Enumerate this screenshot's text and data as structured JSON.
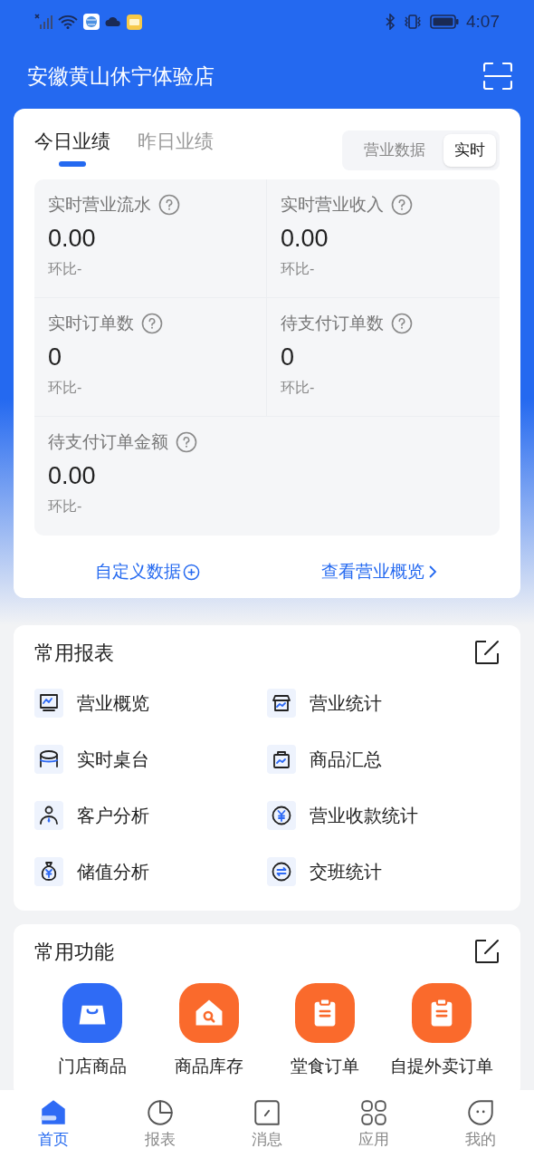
{
  "status_bar": {
    "time": "4:07"
  },
  "header": {
    "title": "安徽黄山休宁体验店"
  },
  "performance": {
    "tabs": [
      {
        "label": "今日业绩",
        "selected": true
      },
      {
        "label": "昨日业绩",
        "selected": false
      }
    ],
    "mode_toggle": [
      {
        "label": "营业数据",
        "selected": false
      },
      {
        "label": "实时",
        "selected": true
      }
    ],
    "metrics": [
      {
        "label": "实时营业流水",
        "value": "0.00",
        "compare": "环比-"
      },
      {
        "label": "实时营业收入",
        "value": "0.00",
        "compare": "环比-"
      },
      {
        "label": "实时订单数",
        "value": "0",
        "compare": "环比-"
      },
      {
        "label": "待支付订单数",
        "value": "0",
        "compare": "环比-"
      },
      {
        "label": "待支付订单金额",
        "value": "0.00",
        "compare": "环比-"
      }
    ],
    "links": [
      {
        "label": "自定义数据",
        "kind": "add"
      },
      {
        "label": "查看营业概览",
        "kind": "chevron"
      }
    ]
  },
  "reports": {
    "title": "常用报表",
    "items": [
      {
        "label": "营业概览",
        "kind": "monitor"
      },
      {
        "label": "营业统计",
        "kind": "store"
      },
      {
        "label": "实时桌台",
        "kind": "table"
      },
      {
        "label": "商品汇总",
        "kind": "bag"
      },
      {
        "label": "客户分析",
        "kind": "person"
      },
      {
        "label": "营业收款统计",
        "kind": "yen"
      },
      {
        "label": "储值分析",
        "kind": "moneybag"
      },
      {
        "label": "交班统计",
        "kind": "exchange"
      }
    ]
  },
  "functions": {
    "title": "常用功能",
    "items": [
      {
        "label": "门店商品",
        "kind": "bag",
        "color": "#2f6bf5"
      },
      {
        "label": "商品库存",
        "kind": "house",
        "color": "#fa6a2c"
      },
      {
        "label": "堂食订单",
        "kind": "clipboard",
        "color": "#fa6a2c"
      },
      {
        "label": "自提外卖订单",
        "kind": "clipboard",
        "color": "#fa6a2c"
      }
    ]
  },
  "tab_bar": [
    {
      "label": "首页",
      "kind": "home",
      "selected": true
    },
    {
      "label": "报表",
      "kind": "pie",
      "selected": false
    },
    {
      "label": "消息",
      "kind": "message",
      "selected": false
    },
    {
      "label": "应用",
      "kind": "apps",
      "selected": false
    },
    {
      "label": "我的",
      "kind": "me",
      "selected": false
    }
  ]
}
